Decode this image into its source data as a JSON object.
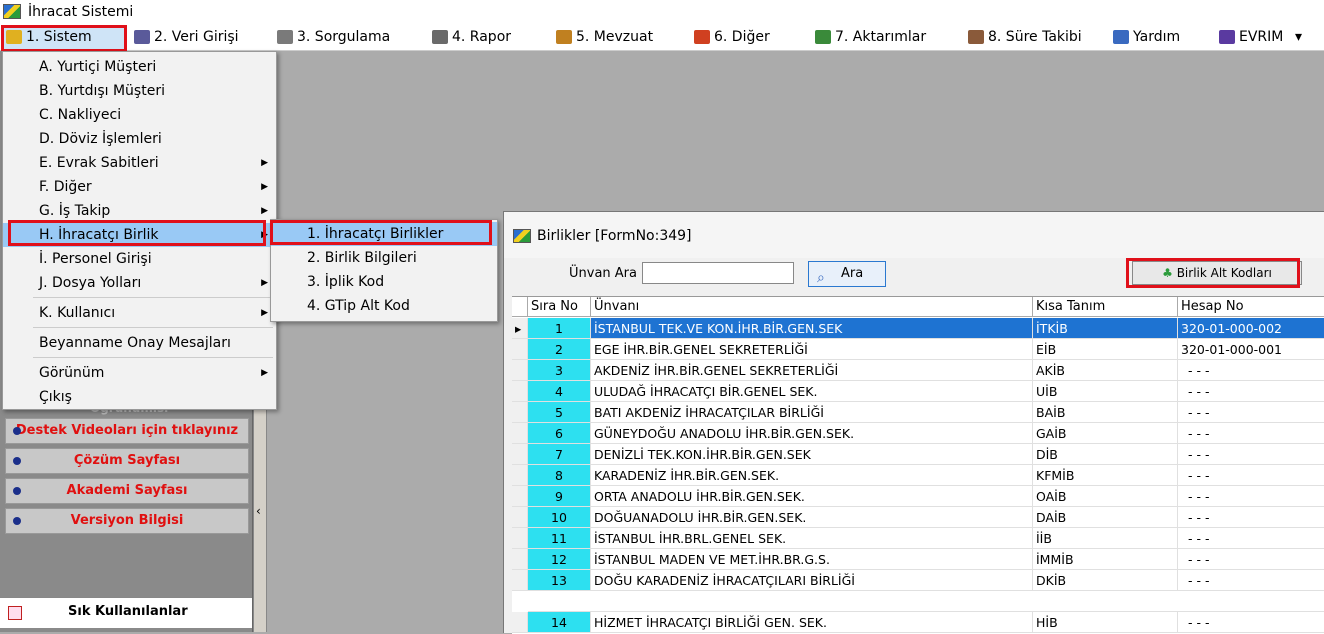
{
  "window": {
    "title": "İhracat Sistemi"
  },
  "menubar": [
    {
      "label": "1.  Sistem",
      "color": "#e0b020"
    },
    {
      "label": "2.  Veri Girişi",
      "color": "#5a5a9a"
    },
    {
      "label": "3.  Sorgulama",
      "color": "#7a7a7a"
    },
    {
      "label": "4.  Rapor",
      "color": "#6a6a6a"
    },
    {
      "label": "5.  Mevzuat",
      "color": "#c08020"
    },
    {
      "label": "6.  Diğer",
      "color": "#d04020"
    },
    {
      "label": "7.  Aktarımlar",
      "color": "#3a8a3a"
    },
    {
      "label": "8. Süre Takibi",
      "color": "#8a5a3a"
    },
    {
      "label": "Yardım",
      "color": "#3a6ac0"
    },
    {
      "label": "EVRIM",
      "color": "#5a3aa0"
    }
  ],
  "sistem_menu": [
    {
      "label": "A.  Yurtiçi Müşteri",
      "submenu": false
    },
    {
      "label": "B.  Yurtdışı Müşteri",
      "submenu": false
    },
    {
      "label": "C.  Nakliyeci",
      "submenu": false
    },
    {
      "label": "D.  Döviz İşlemleri",
      "submenu": false
    },
    {
      "label": "E.  Evrak Sabitleri",
      "submenu": true
    },
    {
      "label": "F.  Diğer",
      "submenu": true
    },
    {
      "label": "G.  İş Takip",
      "submenu": true
    },
    {
      "label": "H.  İhracatçı Birlik",
      "submenu": true
    },
    {
      "label": "İ.   Personel Girişi",
      "submenu": false
    },
    {
      "label": "J.  Dosya Yolları",
      "submenu": true
    },
    {
      "label": "K.  Kullanıcı",
      "submenu": true
    },
    {
      "label": "Beyanname Onay Mesajları",
      "submenu": false
    },
    {
      "label": "Görünüm",
      "submenu": true
    },
    {
      "label": "Çıkış",
      "submenu": false
    }
  ],
  "birlik_submenu": [
    {
      "label": "1.  İhracatçı Birlikler"
    },
    {
      "label": "2.  Birlik Bilgileri"
    },
    {
      "label": "3.  İplik Kod"
    },
    {
      "label": "4.  GTip Alt Kod"
    }
  ],
  "side_panel": {
    "partial_label": "Oğrunumisi",
    "buttons": [
      {
        "label": "Destek Videoları için tıklayınız"
      },
      {
        "label": "Çözüm Sayfası"
      },
      {
        "label": "Akademi Sayfası"
      },
      {
        "label": "Versiyon Bilgisi"
      }
    ],
    "sik_kullanilanlar": "Sık Kullanılanlar"
  },
  "form": {
    "title": "Birlikler [FormNo:349]",
    "search_label": "Ünvan Ara",
    "search_value": "",
    "search_button": "Ara",
    "alt_codes_button": "Birlik Alt Kodları",
    "columns": [
      "Sıra No",
      "Ünvanı",
      "Kısa Tanım",
      "Hesap No"
    ],
    "rows": [
      {
        "no": "1",
        "unvan": "İSTANBUL TEK.VE KON.İHR.BİR.GEN.SEK",
        "kisa": "İTKİB",
        "hesap": "320-01-000-002"
      },
      {
        "no": "2",
        "unvan": "EGE İHR.BİR.GENEL SEKRETERLİĞİ",
        "kisa": "EİB",
        "hesap": "320-01-000-001"
      },
      {
        "no": "3",
        "unvan": "AKDENİZ İHR.BİR.GENEL SEKRETERLİĞİ",
        "kisa": "AKİB",
        "hesap": "- - -"
      },
      {
        "no": "4",
        "unvan": "ULUDAĞ İHRACATÇI BİR.GENEL SEK.",
        "kisa": "UİB",
        "hesap": "- - -"
      },
      {
        "no": "5",
        "unvan": "BATI AKDENİZ İHRACATÇILAR BİRLİĞİ",
        "kisa": "BAİB",
        "hesap": "- - -"
      },
      {
        "no": "6",
        "unvan": "GÜNEYDOĞU ANADOLU İHR.BİR.GEN.SEK.",
        "kisa": "GAİB",
        "hesap": "- - -"
      },
      {
        "no": "7",
        "unvan": "DENİZLİ TEK.KON.İHR.BİR.GEN.SEK",
        "kisa": "DİB",
        "hesap": "- - -"
      },
      {
        "no": "8",
        "unvan": "KARADENİZ İHR.BİR.GEN.SEK.",
        "kisa": "KFMİB",
        "hesap": "- - -"
      },
      {
        "no": "9",
        "unvan": "ORTA ANADOLU İHR.BİR.GEN.SEK.",
        "kisa": "OAİB",
        "hesap": "- - -"
      },
      {
        "no": "10",
        "unvan": "DOĞUANADOLU İHR.BİR.GEN.SEK.",
        "kisa": "DAİB",
        "hesap": "- - -"
      },
      {
        "no": "11",
        "unvan": "İSTANBUL İHR.BRL.GENEL SEK.",
        "kisa": "İİB",
        "hesap": "- - -"
      },
      {
        "no": "12",
        "unvan": "İSTANBUL MADEN VE MET.İHR.BR.G.S.",
        "kisa": "İMMİB",
        "hesap": "- - -"
      },
      {
        "no": "13",
        "unvan": "DOĞU KARADENİZ İHRACATÇILARI BİRLİĞİ",
        "kisa": "DKİB",
        "hesap": "- - -"
      },
      {
        "no": "14",
        "unvan": "HİZMET İHRACATÇI BİRLİĞİ GEN. SEK.",
        "kisa": "HİB",
        "hesap": "- - -"
      }
    ]
  }
}
